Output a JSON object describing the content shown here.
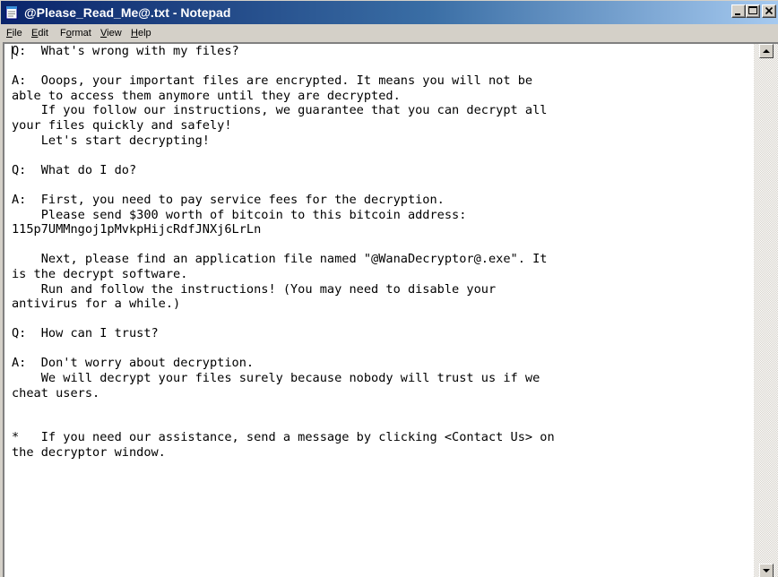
{
  "window": {
    "title": "@Please_Read_Me@.txt - Notepad",
    "controls": {
      "minimize": "minimize-icon",
      "maximize": "maximize-icon",
      "close": "close-icon"
    }
  },
  "menu": {
    "file": {
      "mnemonic": "F",
      "rest": "ile"
    },
    "edit": {
      "mnemonic": "E",
      "rest": "dit"
    },
    "format": {
      "pre": "F",
      "mnemonic": "o",
      "rest": "rmat"
    },
    "view": {
      "mnemonic": "V",
      "rest": "iew"
    },
    "help": {
      "mnemonic": "H",
      "rest": "elp"
    }
  },
  "document": {
    "text": "Q:  What's wrong with my files?\n\nA:  Ooops, your important files are encrypted. It means you will not be\nable to access them anymore until they are decrypted.\n    If you follow our instructions, we guarantee that you can decrypt all\nyour files quickly and safely!\n    Let's start decrypting!\n\nQ:  What do I do?\n\nA:  First, you need to pay service fees for the decryption.\n    Please send $300 worth of bitcoin to this bitcoin address:\n115p7UMMngoj1pMvkpHijcRdfJNXj6LrLn\n\n    Next, please find an application file named \"@WanaDecryptor@.exe\". It\nis the decrypt software.\n    Run and follow the instructions! (You may need to disable your\nantivirus for a while.)\n\nQ:  How can I trust?\n\nA:  Don't worry about decryption.\n    We will decrypt your files surely because nobody will trust us if we\ncheat users.\n\n\n*   If you need our assistance, send a message by clicking <Contact Us> on\nthe decryptor window."
  },
  "colors": {
    "title_bar_start": "#0a246a",
    "title_bar_end": "#a6caf0",
    "chrome": "#d4d0c8",
    "text": "#000000"
  }
}
